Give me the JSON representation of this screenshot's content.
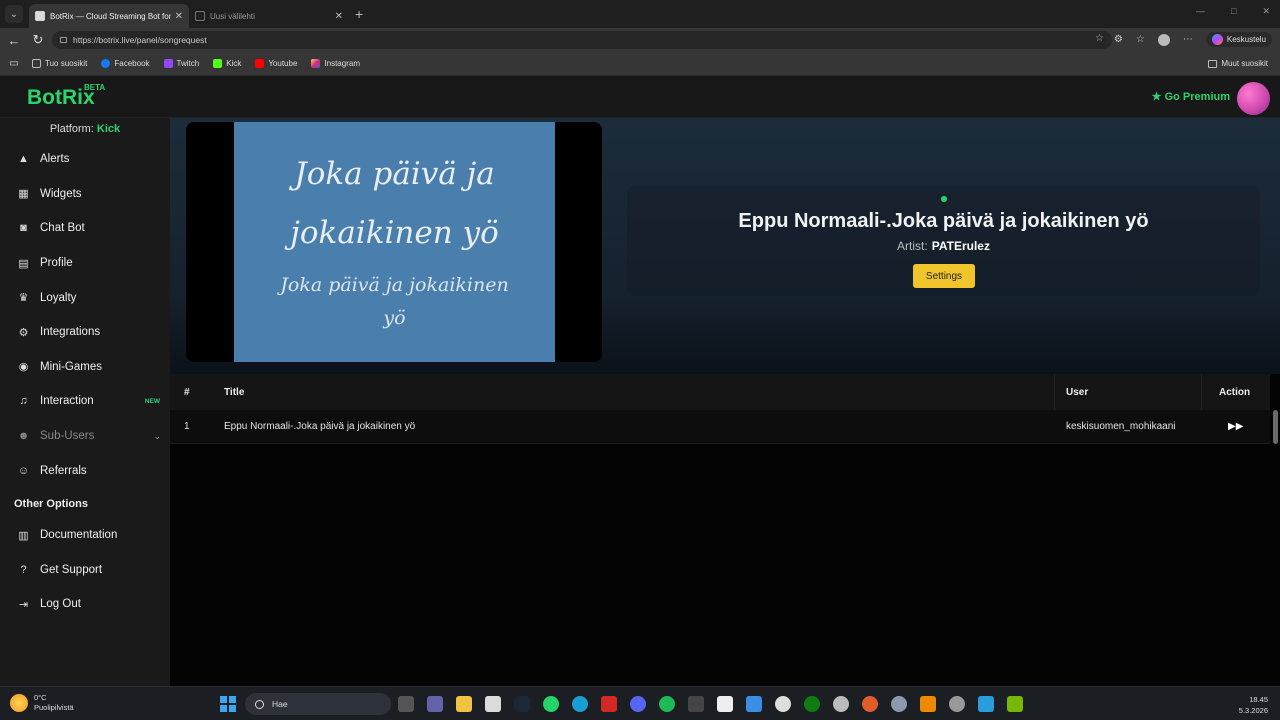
{
  "browser": {
    "tabs": [
      {
        "title": "BotRix — Cloud Streaming Bot for",
        "active": true
      },
      {
        "title": "Uusi välilehti",
        "active": false
      }
    ],
    "new_tab": "+",
    "url": "https://botrix.live/panel/songrequest",
    "copilot_label": "Keskustelu",
    "bookmarks": [
      "Tuo suosikit",
      "Facebook",
      "Twitch",
      "Kick",
      "Youtube",
      "Instagram"
    ],
    "other_favorites": "Muut suosikit"
  },
  "app": {
    "logo": "BotRix",
    "logo_badge": "BETA",
    "premium_label": "Go Premium",
    "platform_label": "Platform:",
    "platform_value": "Kick",
    "nav": [
      {
        "label": "Alerts",
        "icon": "warning-icon"
      },
      {
        "label": "Widgets",
        "icon": "widgets-icon"
      },
      {
        "label": "Chat Bot",
        "icon": "robot-icon"
      },
      {
        "label": "Profile",
        "icon": "id-card-icon"
      },
      {
        "label": "Loyalty",
        "icon": "trophy-icon"
      },
      {
        "label": "Integrations",
        "icon": "integrations-icon"
      },
      {
        "label": "Mini-Games",
        "icon": "gamepad-icon"
      },
      {
        "label": "Interaction",
        "icon": "music-icon",
        "badge": "NEW"
      },
      {
        "label": "Sub-Users",
        "icon": "users-icon"
      },
      {
        "label": "Referrals",
        "icon": "referrals-icon"
      }
    ],
    "other_options_heading": "Other Options",
    "other_options": [
      {
        "label": "Documentation",
        "icon": "book-icon"
      },
      {
        "label": "Get Support",
        "icon": "question-icon"
      },
      {
        "label": "Log Out",
        "icon": "logout-icon"
      }
    ]
  },
  "player": {
    "video_lines": [
      "Joka päivä ja",
      "jokaikinen yö",
      "Joka päivä ja jokaikinen",
      "yö"
    ],
    "now_playing_title": "Eppu Normaali-.Joka päivä ja jokaikinen yö",
    "artist_label": "Artist:",
    "artist_value": "PATErulez",
    "settings_label": "Settings"
  },
  "queue": {
    "columns": {
      "num": "#",
      "title": "Title",
      "user": "User",
      "action": "Action"
    },
    "rows": [
      {
        "num": "1",
        "title": "Eppu Normaali-.Joka päivä ja jokaikinen yö",
        "user": "keskisuomen_mohikaani"
      }
    ]
  },
  "taskbar": {
    "temperature": "0°C",
    "weather": "Puolipilvistä",
    "search_placeholder": "Hae",
    "time": "18.45",
    "date": "5.3.2026"
  },
  "colors": {
    "accent": "#2bd46d",
    "settings_button": "#f0c52c",
    "sidebar_bg": "#1a1a1a"
  }
}
